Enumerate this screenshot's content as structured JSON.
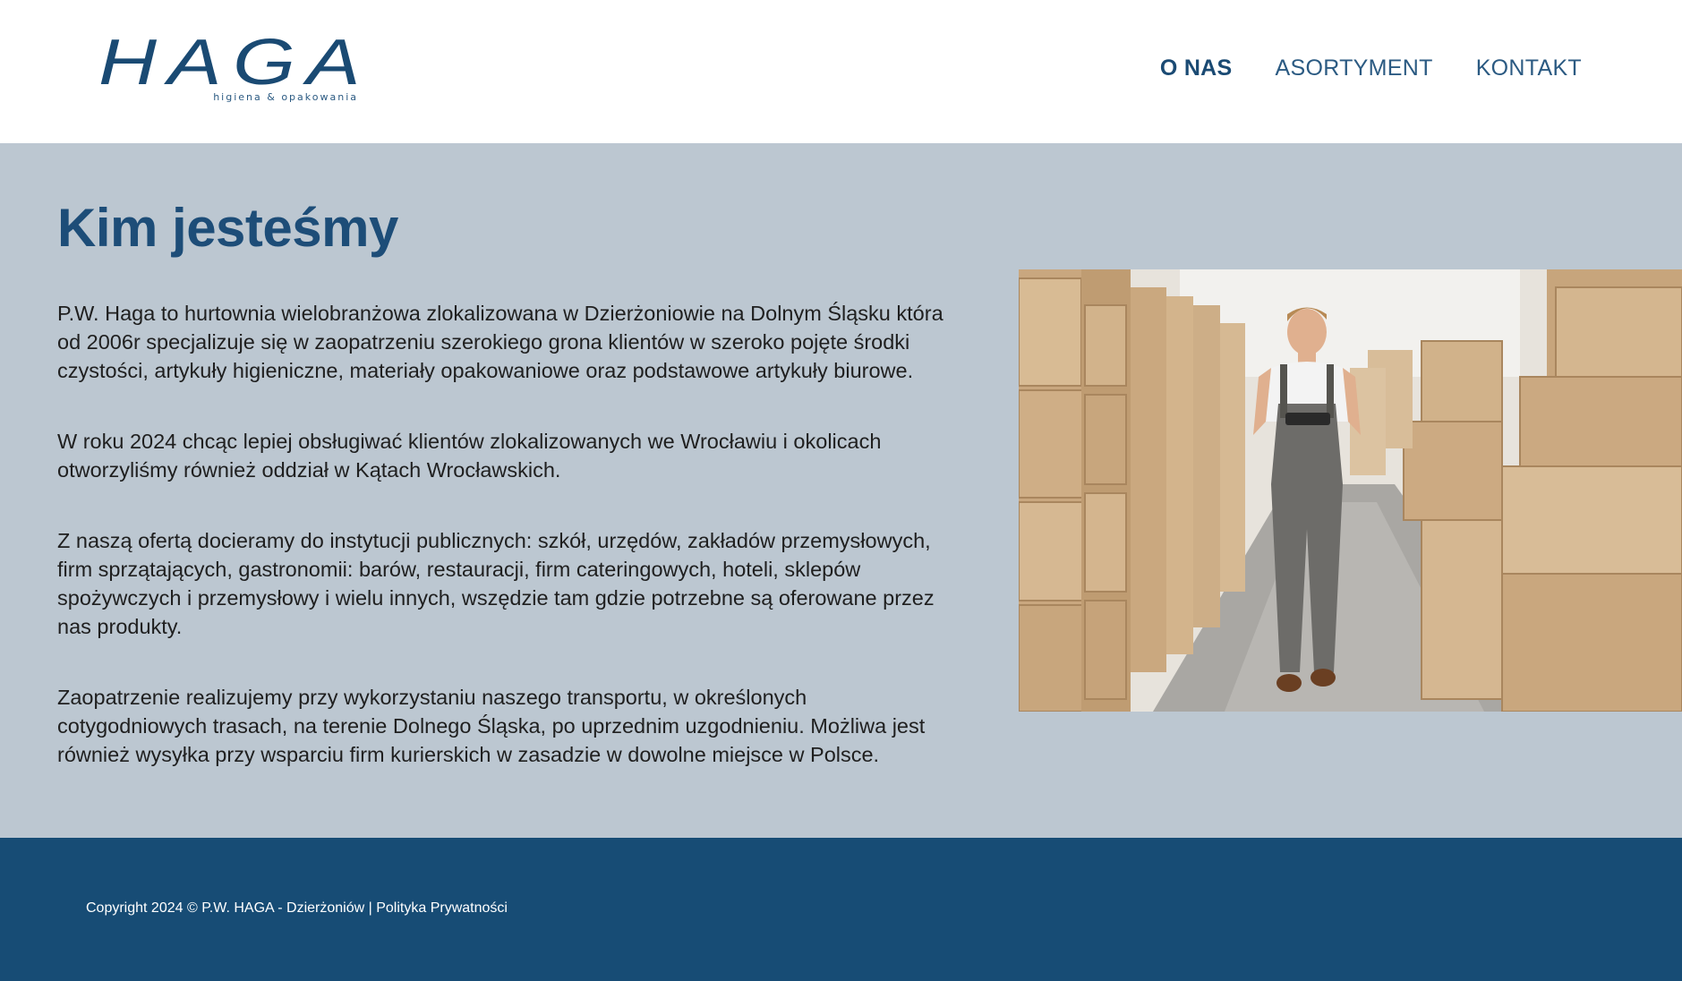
{
  "header": {
    "logo_text": "HAGA",
    "logo_tagline": "higiena & opakowania",
    "nav": [
      {
        "label": "O NAS"
      },
      {
        "label": "ASORTYMENT"
      },
      {
        "label": "KONTAKT"
      }
    ]
  },
  "main": {
    "title": "Kim jesteśmy",
    "paragraphs": [
      "P.W. Haga to hurtownia wielobranżowa zlokalizowana w Dzierżoniowie na Dolnym Śląsku która od 2006r specjalizuje się w zaopatrzeniu szerokiego grona klientów w szeroko pojęte środki czystości, artykuły higieniczne, materiały opakowaniowe oraz podstawowe artykuły biurowe.",
      "W roku 2024 chcąc lepiej obsługiwać klientów zlokalizowanych we Wrocławiu i okolicach otworzyliśmy również oddział w Kątach Wrocławskich.",
      "Z naszą ofertą docieramy do instytucji publicznych: szkół, urzędów, zakładów przemysłowych, firm sprzątających, gastronomii: barów, restauracji, firm cateringowych, hoteli, sklepów spożywczych i przemysłowy i wielu innych, wszędzie tam gdzie potrzebne są oferowane przez nas produkty.",
      "Zaopatrzenie realizujemy przy wykorzystaniu naszego transportu, w określonych cotygodniowych trasach, na terenie Dolnego Śląska, po uprzednim uzgodnieniu. Możliwa jest również wysyłka przy wsparciu firm kurierskich w zasadzie w dowolne miejsce w Polsce."
    ],
    "image_icon": "warehouse-worker-photo"
  },
  "footer": {
    "copyright": "Copyright 2024 © P.W. HAGA - Dzierżoniów | ",
    "privacy_link": "Polityka Prywatności"
  },
  "colors": {
    "brand_blue": "#1a4a73",
    "main_bg": "#bcc7d1",
    "footer_bg": "#174c75"
  }
}
